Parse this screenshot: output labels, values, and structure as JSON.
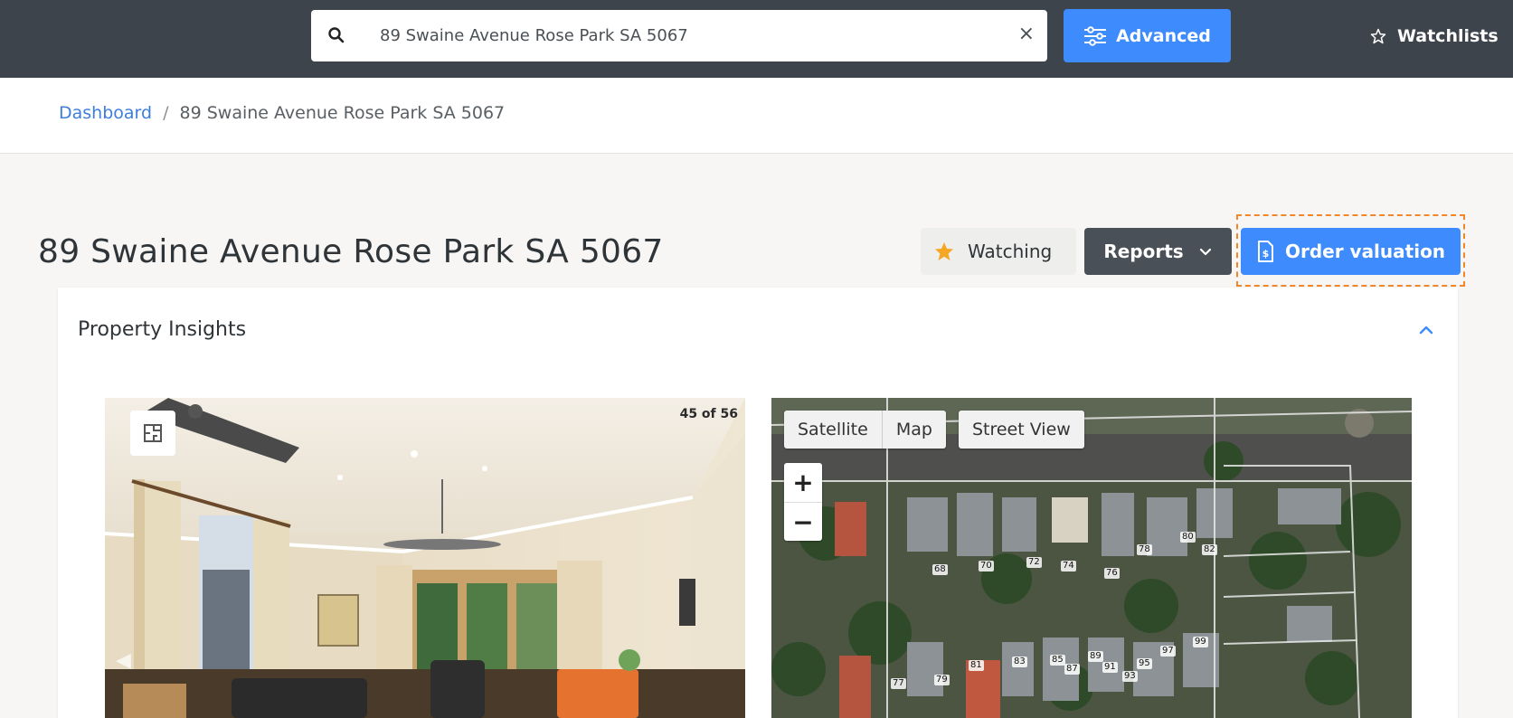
{
  "search": {
    "value": "89 Swaine Avenue Rose Park SA 5067",
    "clear_glyph": "×"
  },
  "header": {
    "advanced_label": "Advanced",
    "watchlists_label": "Watchlists"
  },
  "breadcrumb": {
    "home": "Dashboard",
    "separator": "/",
    "current": "89 Swaine Avenue Rose Park SA 5067"
  },
  "page": {
    "title": "89 Swaine Avenue Rose Park SA 5067"
  },
  "actions": {
    "watching_label": "Watching",
    "reports_label": "Reports",
    "order_label": "Order valuation"
  },
  "insights": {
    "title": "Property Insights",
    "photo_counter": "45 of 56",
    "map_tabs": [
      "Satellite",
      "Map"
    ],
    "street_view_label": "Street View",
    "zoom_in": "+",
    "zoom_out": "−",
    "lot_numbers": [
      "68",
      "70",
      "72",
      "74",
      "76",
      "78",
      "80",
      "82",
      "77",
      "79",
      "81",
      "83",
      "85",
      "87",
      "89",
      "91",
      "93",
      "95",
      "97",
      "99"
    ]
  },
  "colors": {
    "topbar": "#3e444b",
    "primary": "#3d8bfd",
    "reports": "#4a5057",
    "star": "#f5a623",
    "highlight": "#f0872b",
    "link": "#3d7edc"
  },
  "icons": {
    "search": "search-icon",
    "advanced": "sliders-icon",
    "watchlists": "star-outline-icon",
    "watching": "star-filled-icon",
    "reports": "chevron-down-icon",
    "order": "document-dollar-icon",
    "collapse": "chevron-up-icon",
    "floorplan": "floorplan-icon"
  }
}
